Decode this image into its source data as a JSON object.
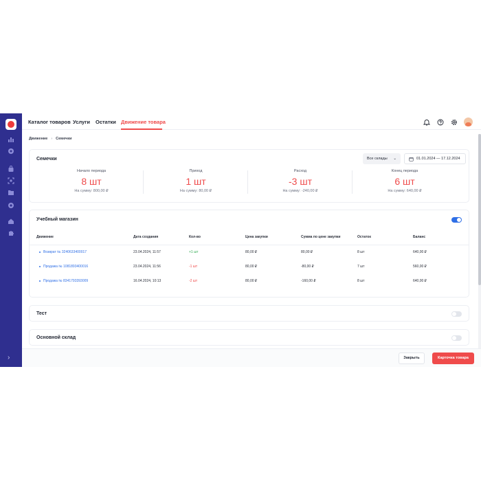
{
  "nav": {
    "tabs": [
      {
        "label": "Каталог товаров"
      },
      {
        "label": "Услуги"
      },
      {
        "label": "Остатки"
      },
      {
        "label": "Движение товара"
      }
    ]
  },
  "breadcrumb": {
    "root": "Движение",
    "current": "Семечки"
  },
  "summary": {
    "title": "Семечки",
    "warehouse_select": "Все склады",
    "date_range": "01.01.2024 — 17.12.2024",
    "stats": [
      {
        "label": "Начало периода",
        "value": "8 шт",
        "sum": "На сумму: 800,00 ₽"
      },
      {
        "label": "Приход",
        "value": "1 шт",
        "sum": "На сумму: 80,00 ₽"
      },
      {
        "label": "Расход",
        "value": "-3 шт",
        "sum": "На сумму: -240,00 ₽"
      },
      {
        "label": "Конец периода",
        "value": "6 шт",
        "sum": "На сумму: 640,00 ₽"
      }
    ]
  },
  "store": {
    "title": "Учебный магазин",
    "toggle_on": true,
    "columns": [
      "Движение",
      "Дата создания",
      "Кол-во",
      "Цена закупки",
      "Сумма по цене закупки",
      "Остаток",
      "Баланс"
    ],
    "rows": [
      {
        "movement": "Возврат № 3240633400017",
        "date": "23.04.2024, 11:57",
        "qty": "+1 шт",
        "price": "80,00 ₽",
        "sum": "80,00 ₽",
        "rest": "8 шт",
        "balance": "640,00 ₽"
      },
      {
        "movement": "Продажа № 1081893400016",
        "date": "23.04.2024, 11:56",
        "qty": "-1 шт",
        "price": "80,00 ₽",
        "sum": "-80,00 ₽",
        "rest": "7 шт",
        "balance": "560,00 ₽"
      },
      {
        "movement": "Продажа № 8341793393009",
        "date": "16.04.2024, 10:13",
        "qty": "-2 шт",
        "price": "80,00 ₽",
        "sum": "-160,00 ₽",
        "rest": "8 шт",
        "balance": "640,00 ₽"
      }
    ]
  },
  "warehouses": [
    {
      "title": "Тест",
      "toggle_on": false
    },
    {
      "title": "Основной склад",
      "toggle_on": false
    }
  ],
  "footer": {
    "close_label": "Закрыть",
    "card_label": "Карточка товара"
  },
  "icons": {
    "sidebar": [
      "logo-icon",
      "chart-icon",
      "compass-icon",
      "bag-icon",
      "scan-icon",
      "folder-icon",
      "gear-circle-icon",
      "home-icon",
      "puzzle-icon",
      "chevron-right-icon"
    ],
    "header": [
      "bell-icon",
      "help-icon",
      "settings-icon",
      "avatar"
    ]
  },
  "colors": {
    "accent": "#ef4b4b",
    "sidebar": "#2f2f8f",
    "link": "#2f6fe6",
    "positive": "#2ea94f"
  }
}
